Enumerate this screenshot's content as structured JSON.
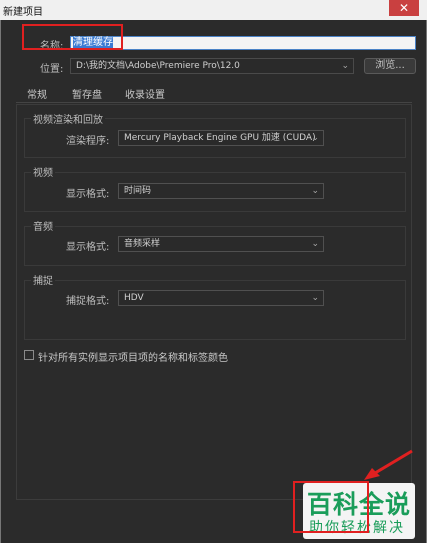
{
  "window": {
    "title": "新建项目",
    "close_glyph": "✕"
  },
  "name_field": {
    "label": "名称:",
    "value": "清理缓存"
  },
  "location": {
    "label": "位置:",
    "value": "D:\\我的文档\\Adobe\\Premiere Pro\\12.0",
    "browse_label": "浏览..."
  },
  "tabs": [
    {
      "label": "常规",
      "active": true
    },
    {
      "label": "暂存盘",
      "active": false
    },
    {
      "label": "收录设置",
      "active": false
    }
  ],
  "sections": {
    "render": {
      "title": "视频渲染和回放",
      "field_label": "渲染程序:",
      "value": "Mercury Playback Engine GPU 加速 (CUDA)"
    },
    "video": {
      "title": "视频",
      "field_label": "显示格式:",
      "value": "时间码"
    },
    "audio": {
      "title": "音频",
      "field_label": "显示格式:",
      "value": "音频采样"
    },
    "capture": {
      "title": "捕捉",
      "field_label": "捕捉格式:",
      "value": "HDV"
    }
  },
  "checkbox": {
    "label": "针对所有实例显示项目项的名称和标签颜色",
    "checked": false
  },
  "watermark": {
    "title": "百科全说",
    "subtitle": "助你轻松解决"
  },
  "colors": {
    "background": "#2b2b2b",
    "highlight": "#e02020",
    "watermark_green": "#1a9d5a"
  },
  "icons": {
    "dropdown": "chevron-down-icon",
    "close": "close-icon"
  }
}
